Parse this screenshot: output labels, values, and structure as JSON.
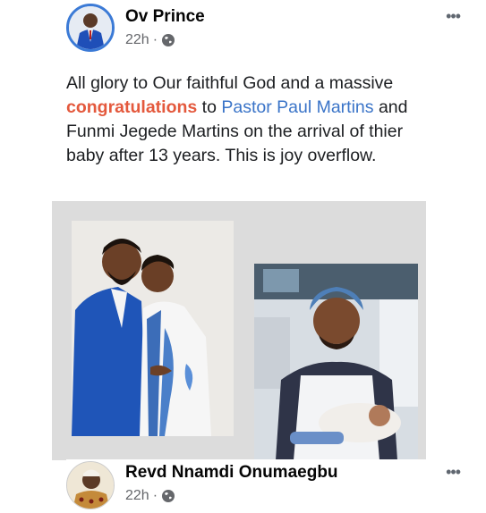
{
  "post": {
    "author": "Ov Prince",
    "time": "22h",
    "separator": "·",
    "more_label": "•••",
    "text_1": "All glory to Our faithful God and a massive ",
    "highlight": "congratulations",
    "text_2": " to ",
    "mention": "Pastor Paul Martins",
    "text_3": " and Funmi Jegede Martins on the arrival of thier baby after 13 years. This is joy overflow."
  },
  "comment": {
    "author": "Revd Nnamdi Onumaegbu",
    "time": "22h",
    "separator": "·",
    "more_label": "•••"
  },
  "colors": {
    "highlight": "#e4593d",
    "link": "#3a74c8",
    "avatar_ring": "#3b7ad6",
    "meta": "#65676b"
  }
}
